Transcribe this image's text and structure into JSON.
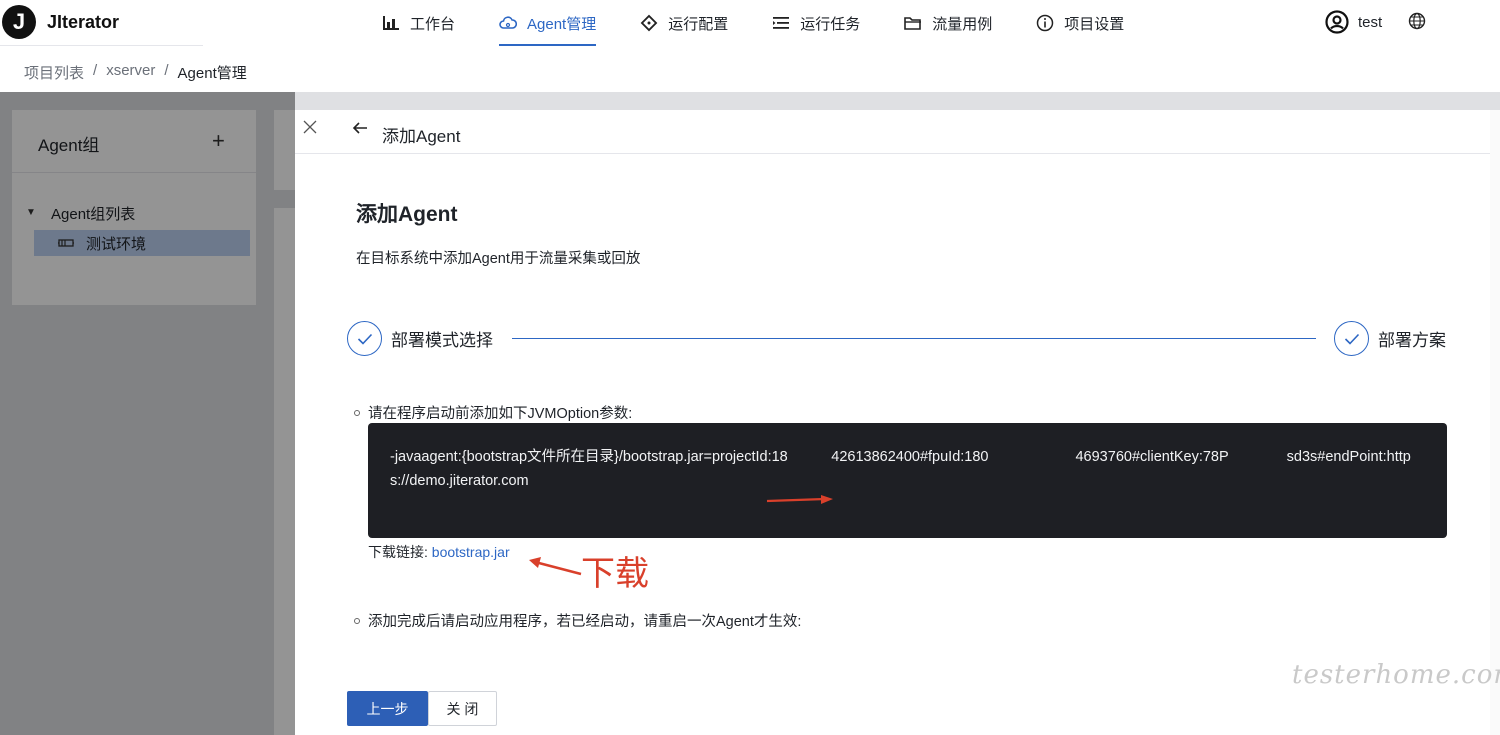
{
  "app": {
    "logo_letter": "J",
    "name": "JIterator"
  },
  "nav": [
    {
      "label": "工作台",
      "icon": "bar-chart-icon",
      "active": false
    },
    {
      "label": "Agent管理",
      "icon": "cloud-icon",
      "active": true
    },
    {
      "label": "运行配置",
      "icon": "diamond-icon",
      "active": false
    },
    {
      "label": "运行任务",
      "icon": "list-icon",
      "active": false
    },
    {
      "label": "流量用例",
      "icon": "folder-icon",
      "active": false
    },
    {
      "label": "项目设置",
      "icon": "info-icon",
      "active": false
    }
  ],
  "user": {
    "name": "test"
  },
  "breadcrumb": [
    "项目列表",
    "/",
    "xserver",
    "/",
    "Agent管理"
  ],
  "left_panel": {
    "title": "Agent组",
    "tree_root": "Agent组列表",
    "tree_node": "测试环境"
  },
  "drawer": {
    "header_title": "添加Agent",
    "title": "添加Agent",
    "subtitle": "在目标系统中添加Agent用于流量采集或回放",
    "steps": [
      "部署模式选择",
      "部署方案"
    ],
    "instruction_1": "请在程序启动前添加如下JVMOption参数:",
    "code": "-javaagent:{bootstrap文件所在目录}/bootstrap.jar=projectId:18   42613862400#fpuId:180      4693760#clientKey:78P    sd3s#endPoint:https://demo.jiterator.com",
    "download_label": "下载链接: ",
    "download_link": "bootstrap.jar",
    "annotation": "下载",
    "instruction_2": "添加完成后请启动应用程序，若已经启动，请重启一次Agent才生效:",
    "btn_prev": "上一步",
    "btn_close": "关 闭"
  },
  "watermark": "testerhome.com",
  "colors": {
    "accent": "#2d67c4",
    "annotation": "#d9402b",
    "code_bg": "#1e1f24"
  }
}
